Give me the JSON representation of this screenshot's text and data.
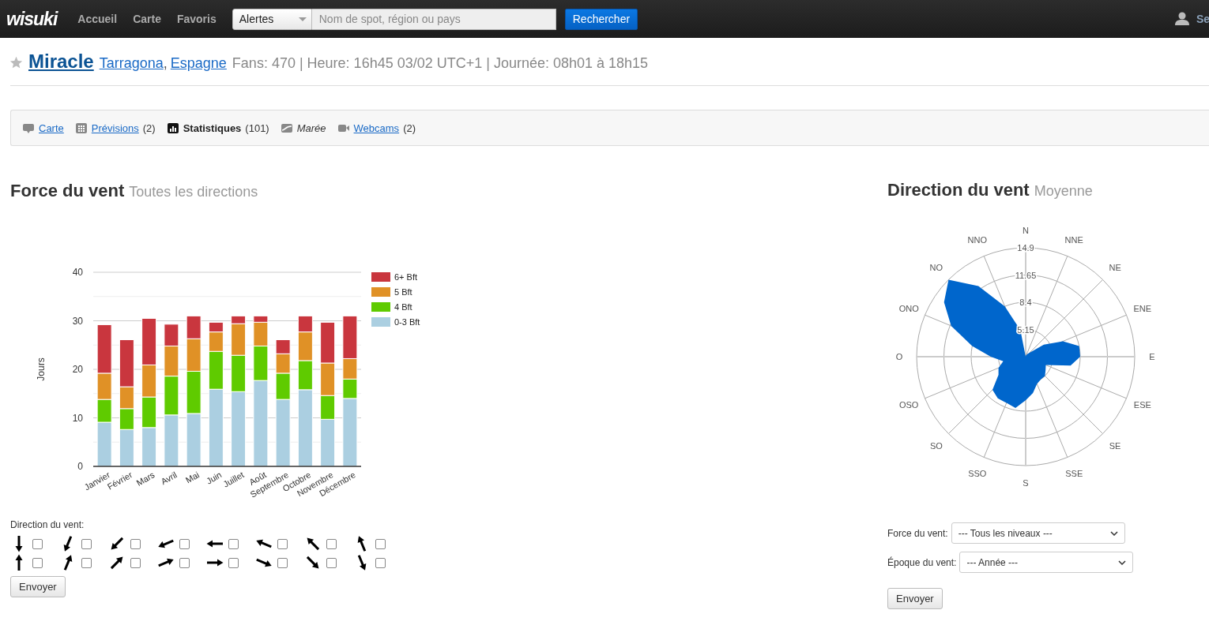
{
  "topbar": {
    "logo": "wisuki",
    "nav": [
      {
        "label": "Accueil"
      },
      {
        "label": "Carte"
      },
      {
        "label": "Favoris"
      }
    ],
    "alert_select": "Alertes",
    "search": {
      "placeholder": "Nom de spot, région ou pays"
    },
    "search_button": "Rechercher",
    "user_link": "Se"
  },
  "spot": {
    "favorite": false,
    "name": "Miracle",
    "region": "Tarragona",
    "separator": ",",
    "country": "Espagne",
    "info": "Fans: 470 | Heure: 16h45 03/02 UTC+1 | Journée: 08h01 à 18h15"
  },
  "tabs": [
    {
      "label": "Carte",
      "selected": false,
      "disabled": false
    },
    {
      "label": "Prévisions",
      "count": "(2)",
      "selected": false,
      "disabled": false
    },
    {
      "label": "Statistiques",
      "count": "(101)",
      "selected": true,
      "disabled": false
    },
    {
      "label": "Marée",
      "selected": false,
      "disabled": true
    },
    {
      "label": "Webcams",
      "count": "(2)",
      "selected": false,
      "disabled": false
    }
  ],
  "force_panel": {
    "title": "Force du vent",
    "subtitle": "Toutes les directions",
    "chart_data": {
      "type": "bar",
      "ylabel": "Jours",
      "stacked": true,
      "grid": true,
      "legend": "right",
      "categories": [
        "Janvier",
        "Février",
        "Mars",
        "Avril",
        "Mai",
        "Juin",
        "Juillet",
        "Août",
        "Septembre",
        "Octobre",
        "Novembre",
        "Décembre"
      ],
      "ylim": [
        0,
        40
      ],
      "yticks": [
        0,
        10,
        20,
        30,
        40
      ],
      "series": [
        {
          "name": "0-3 Bft",
          "color": "#abcfe1",
          "values": [
            9.1,
            7.6,
            8.0,
            10.6,
            10.9,
            15.9,
            15.4,
            17.7,
            13.8,
            15.8,
            9.7,
            14.0
          ]
        },
        {
          "name": "4 Bft",
          "color": "#5fcb00",
          "values": [
            4.7,
            4.3,
            6.3,
            8.0,
            8.7,
            7.8,
            7.5,
            7.1,
            5.4,
            6.0,
            4.9,
            4.0
          ]
        },
        {
          "name": "5 Bft",
          "color": "#e09126",
          "values": [
            5.4,
            4.5,
            6.6,
            6.2,
            6.7,
            4.0,
            6.5,
            4.9,
            4.0,
            5.9,
            6.7,
            4.2
          ]
        },
        {
          "name": "6+ Bft",
          "color": "#c9363e",
          "values": [
            10.0,
            9.7,
            9.6,
            4.5,
            4.7,
            2.0,
            1.6,
            1.3,
            2.9,
            3.3,
            8.4,
            8.8
          ]
        }
      ]
    },
    "direction_filter": {
      "label": "Direction du vent:",
      "options": [
        {
          "checked": false
        },
        {
          "checked": false
        },
        {
          "checked": false
        },
        {
          "checked": false
        },
        {
          "checked": false
        },
        {
          "checked": false
        },
        {
          "checked": false
        },
        {
          "checked": false
        },
        {
          "checked": false
        },
        {
          "checked": false
        },
        {
          "checked": false
        },
        {
          "checked": false
        },
        {
          "checked": false
        },
        {
          "checked": false
        },
        {
          "checked": false
        },
        {
          "checked": false
        }
      ]
    },
    "submit": "Envoyer"
  },
  "direction_panel": {
    "title": "Direction du vent",
    "subtitle": "Moyenne",
    "wind_rose": {
      "directions": [
        "N",
        "NNE",
        "NE",
        "ENE",
        "E",
        "ESE",
        "SE",
        "SSE",
        "S",
        "SSO",
        "SO",
        "OSO",
        "O",
        "ONO",
        "NO",
        "NNO"
      ],
      "ring_labels": [
        "14.9",
        "11.65",
        "8.4",
        "5.15"
      ]
    },
    "filters": [
      {
        "label": "Force du vent:",
        "value": "--- Tous les niveaux ---"
      },
      {
        "label": "Époque du vent:",
        "value": "--- Année ---"
      }
    ],
    "submit": "Envoyer"
  }
}
